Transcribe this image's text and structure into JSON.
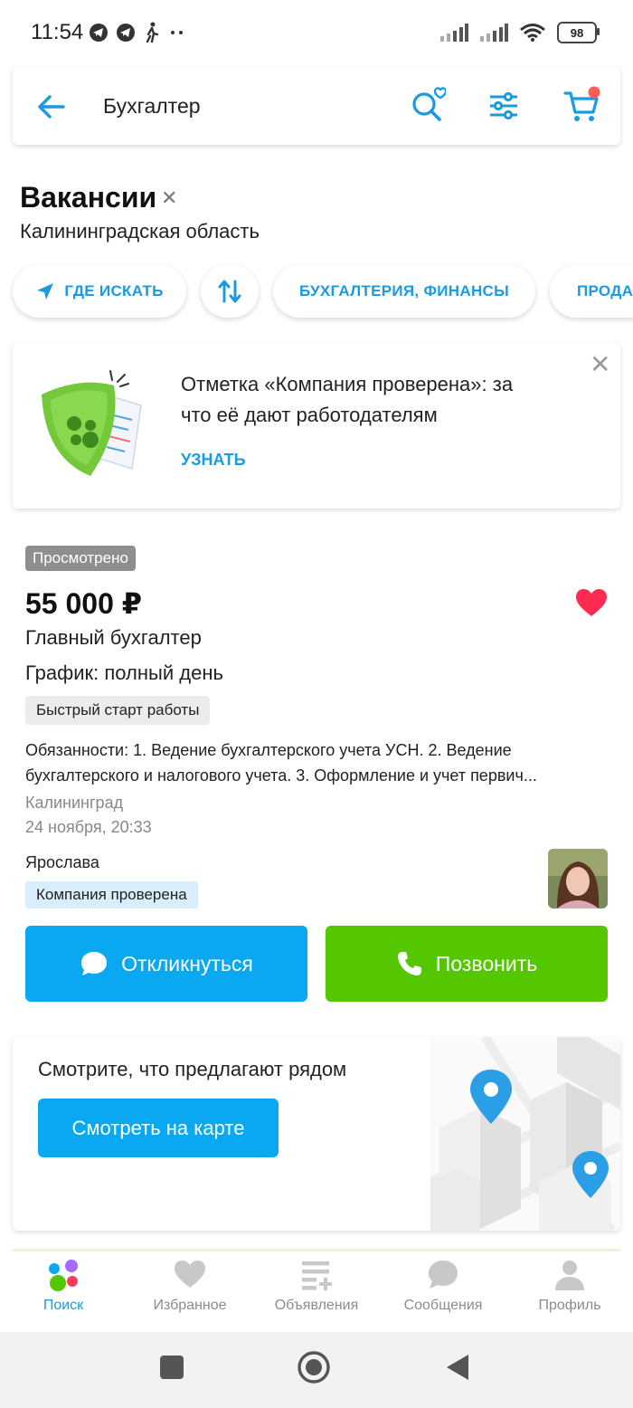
{
  "status_bar": {
    "time": "11:54",
    "battery": "98"
  },
  "header": {
    "search_query": "Бухгалтер"
  },
  "page": {
    "title": "Вакансии",
    "region": "Калининградская область"
  },
  "chips": [
    "ГДЕ ИСКАТЬ",
    "БУХГАЛТЕРИЯ, ФИНАНСЫ",
    "ПРОДА"
  ],
  "promo": {
    "text": "Отметка «Компания проверена»: за что её дают работодателям",
    "link": "УЗНАТЬ"
  },
  "vacancy": {
    "viewed_badge": "Просмотрено",
    "salary": "55 000 ₽",
    "position": "Главный бухгалтер",
    "schedule": "График: полный день",
    "tag": "Быстрый старт работы",
    "description": "Обязанности:  1. Ведение бухгалтерского учета УСН.  2. Ведение бухгалтерского и налогового учета.  3. Оформление и учет первич...",
    "city": "Калининград",
    "date": "24 ноября, 20:33",
    "employer": "Ярослава",
    "verified_tag": "Компания проверена",
    "respond_label": "Откликнуться",
    "call_label": "Позвонить"
  },
  "map_card": {
    "title": "Смотрите, что предлагают рядом",
    "button": "Смотреть на карте"
  },
  "bottom_nav": {
    "items": [
      {
        "label": "Поиск",
        "icon": "search-nav-icon"
      },
      {
        "label": "Избранное",
        "icon": "heart-icon"
      },
      {
        "label": "Объявления",
        "icon": "add-list-icon"
      },
      {
        "label": "Сообщения",
        "icon": "chat-icon"
      },
      {
        "label": "Профиль",
        "icon": "person-icon"
      }
    ]
  },
  "colors": {
    "accent": "#1a9be0",
    "respond_button": "#0aa8f0",
    "call_button": "#55c700",
    "favorite": "#ff2b50"
  }
}
